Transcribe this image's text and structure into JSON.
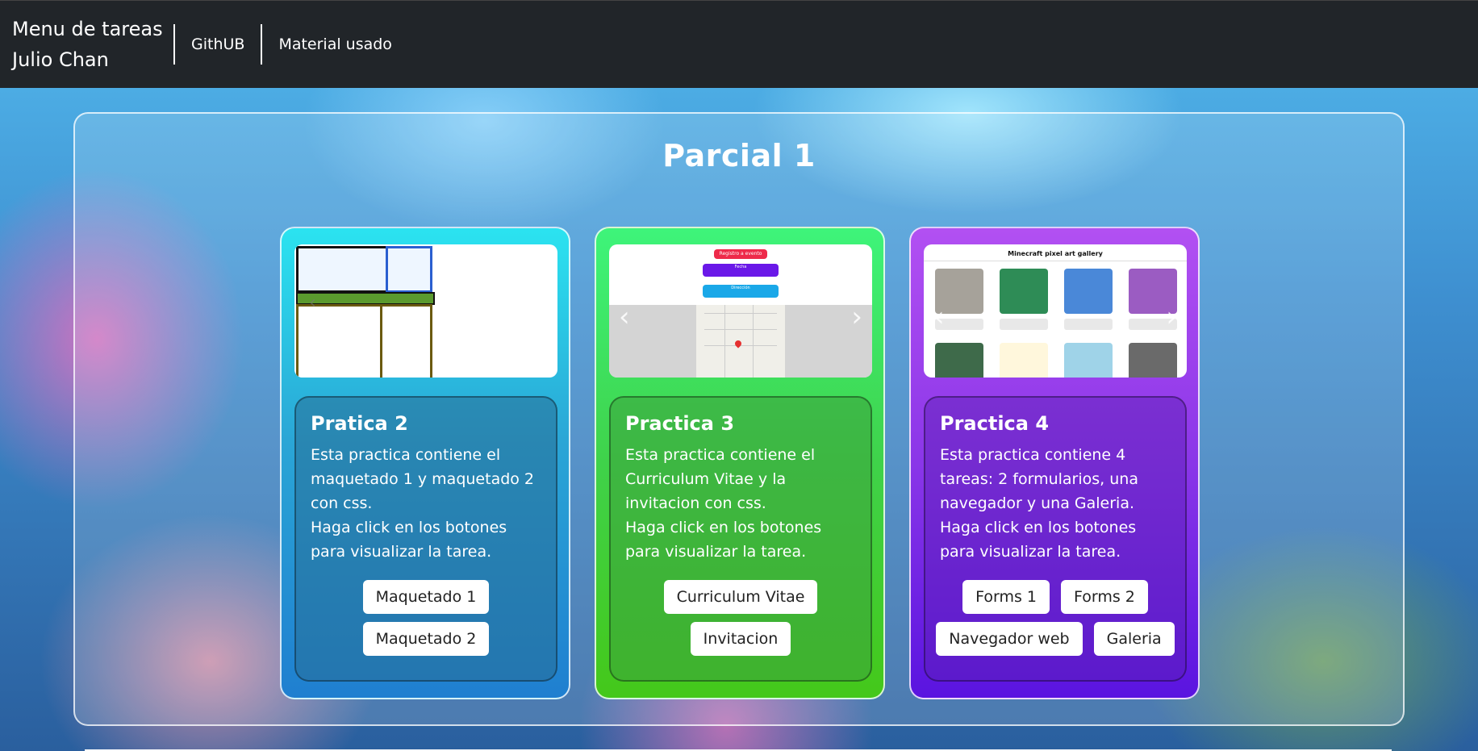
{
  "navbar": {
    "brand_line1": "Menu de tareas",
    "brand_line2": "Julio Chan",
    "links": [
      "GithUB",
      "Material usado"
    ]
  },
  "main": {
    "title": "Parcial 1",
    "cards": [
      {
        "title": "Pratica 2",
        "description_line1": "Esta practica contiene el maquetado 1 y maquetado 2 con css.",
        "description_line2": "Haga click en los botones para visualizar la tarea.",
        "buttons": [
          "Maquetado 1",
          "Maquetado 2"
        ],
        "thumbnail": "maquetado-layout-preview"
      },
      {
        "title": "Practica 3",
        "description_line1": "Esta practica contiene el Curriculum Vitae y la invitacion con css.",
        "description_line2": "Haga click en los botones para visualizar la tarea.",
        "buttons": [
          "Curriculum Vitae",
          "Invitacion"
        ],
        "thumbnail": "invitation-map-preview",
        "thumb_text": [
          "Registro a evento DEMO",
          "Fecha",
          "Dirección"
        ]
      },
      {
        "title": "Practica 4",
        "description_line1": "Esta practica contiene 4 tareas: 2 formularios, una navegador y una Galeria.",
        "description_line2": "Haga click en los botones para visualizar la tarea.",
        "buttons": [
          "Forms 1",
          "Forms 2",
          "Navegador web",
          "Galeria"
        ],
        "thumbnail": "minecraft-gallery-preview",
        "thumb_title": "Minecraft pixel art gallery"
      }
    ]
  },
  "colors": {
    "navbar": "#212529",
    "card1": "#2aa6d6",
    "card2": "#3fd24a",
    "card3": "#8a36e8"
  }
}
